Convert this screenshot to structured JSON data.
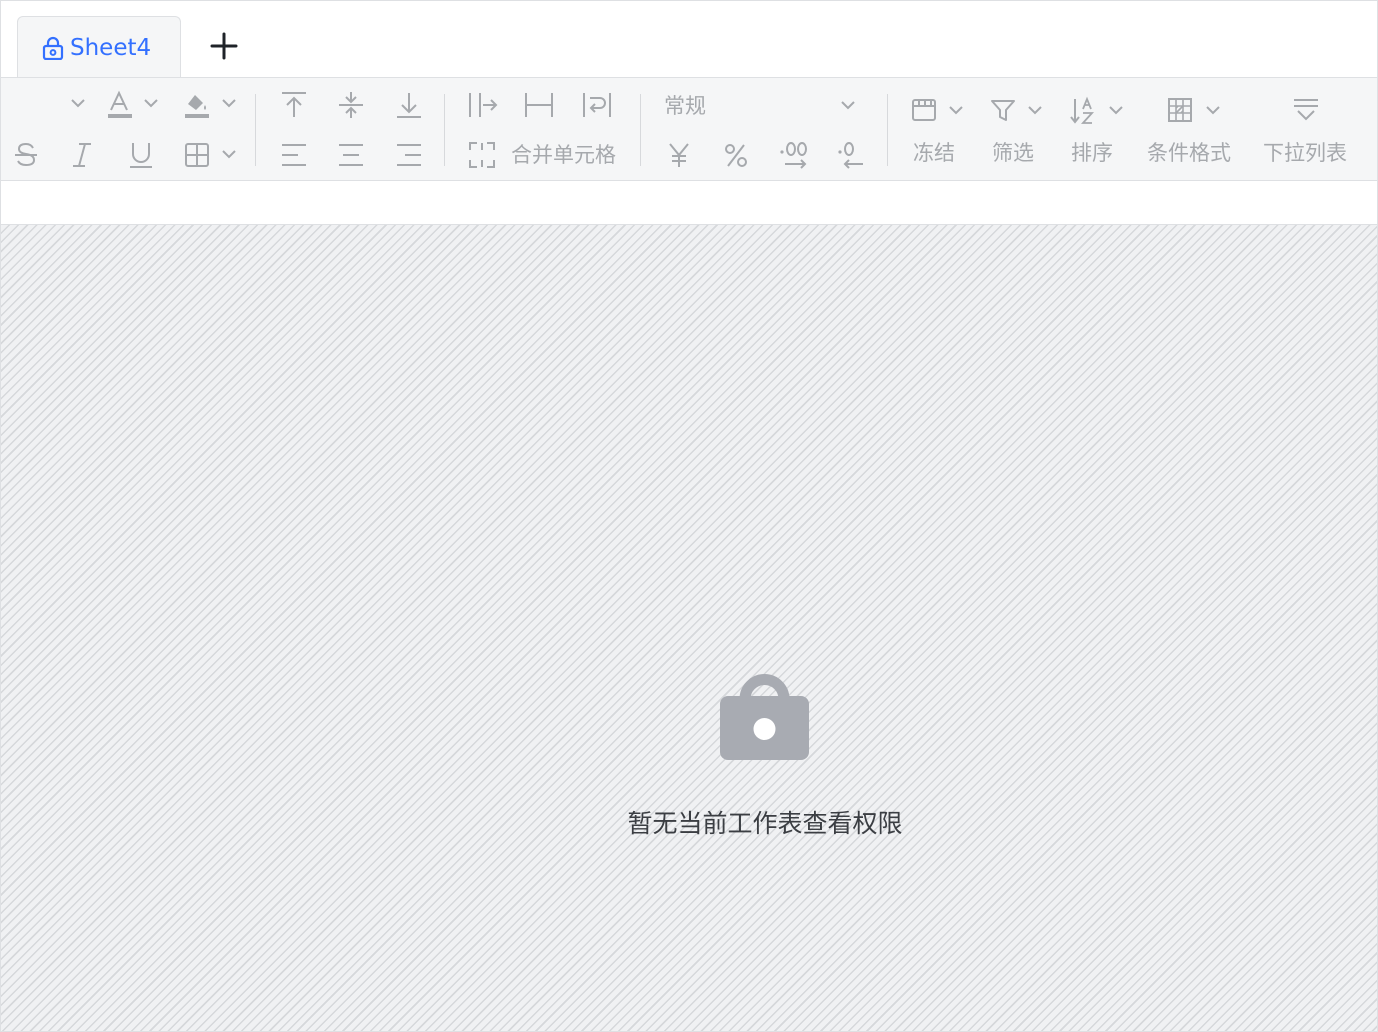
{
  "tabs": [
    {
      "label": "Sheet4",
      "icon": "lock-icon",
      "active": true
    }
  ],
  "add_sheet_icon": "plus-icon",
  "toolbar": {
    "number_format": "常规",
    "merge_label": "合并单元格",
    "freeze_label": "冻结",
    "filter_label": "筛选",
    "sort_label": "排序",
    "conditional_format_label": "条件格式",
    "dropdown_list_label": "下拉列表"
  },
  "permission_message": "暂无当前工作表查看权限",
  "colors": {
    "accent": "#3370ff",
    "icon_disabled": "#a6a9ad",
    "toolbar_bg": "#f5f6f7",
    "lock_gray": "#a8abb2"
  }
}
